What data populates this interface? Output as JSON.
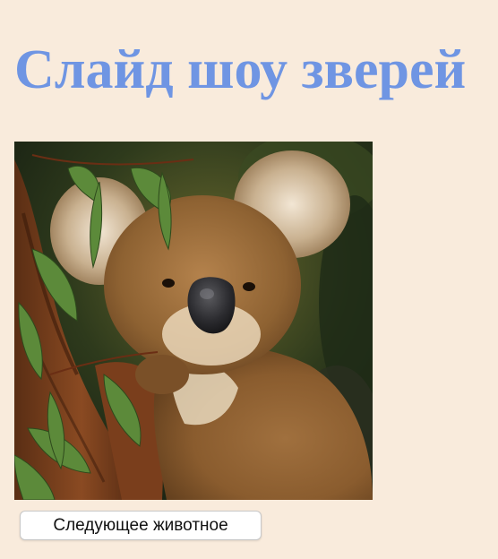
{
  "page": {
    "title": "Слайд шоу зверей",
    "background_color": "#f9ebdc",
    "title_color": "#6f95e3"
  },
  "slideshow": {
    "current_animal": "koala",
    "current_animal_icon": "koala-photo",
    "next_button_label": "Следующее животное"
  }
}
